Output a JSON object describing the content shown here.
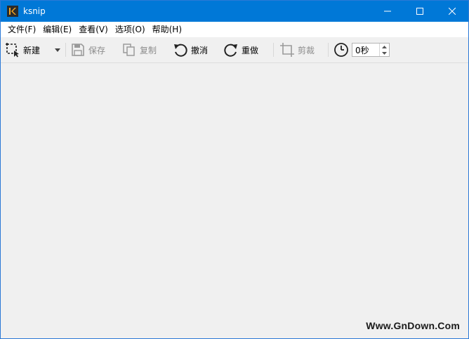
{
  "window": {
    "title": "ksnip"
  },
  "menu": [
    {
      "label": "文件(F)"
    },
    {
      "label": "编辑(E)"
    },
    {
      "label": "查看(V)"
    },
    {
      "label": "选项(O)"
    },
    {
      "label": "帮助(H)"
    }
  ],
  "toolbar": {
    "new_label": "新建",
    "save_label": "保存",
    "copy_label": "复制",
    "undo_label": "撤消",
    "redo_label": "重做",
    "crop_label": "剪裁",
    "delay_value": "0秒"
  },
  "watermark": "Www.GnDown.Com",
  "colors": {
    "titlebar": "#0078d7",
    "background": "#f0f0f0",
    "disabled_text": "#8c8c8c"
  }
}
